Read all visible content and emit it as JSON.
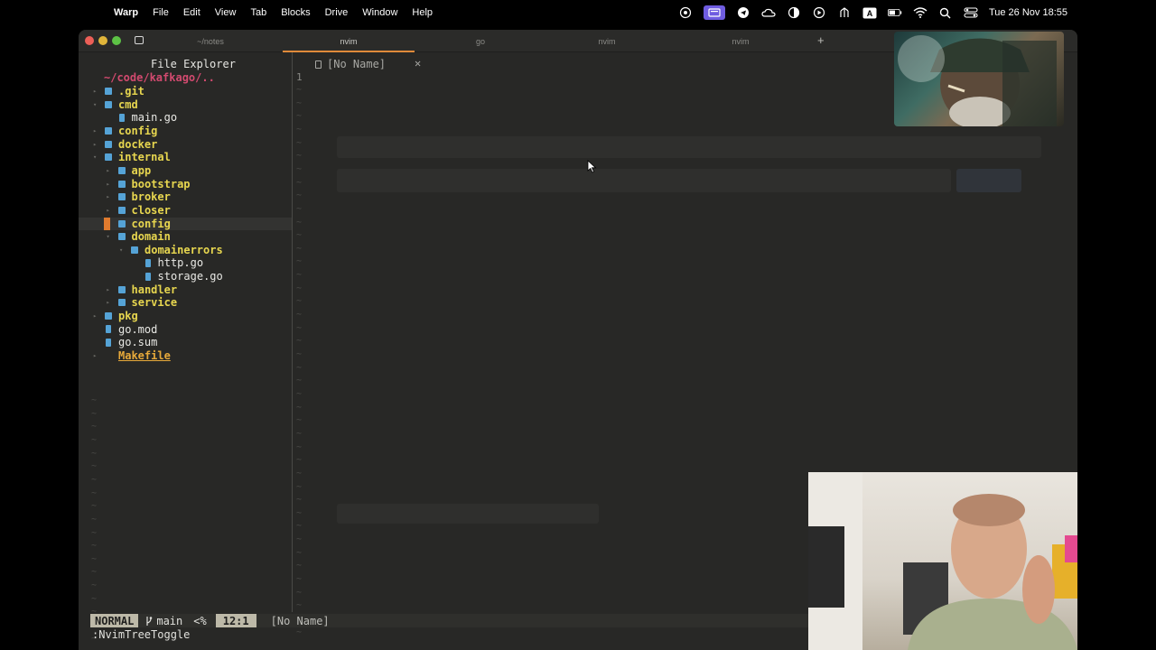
{
  "menubar": {
    "app": "Warp",
    "items": [
      "File",
      "Edit",
      "View",
      "Tab",
      "Blocks",
      "Drive",
      "Window",
      "Help"
    ],
    "clock": "Tue 26 Nov  18:55"
  },
  "window": {
    "tabs": [
      {
        "label": "~/notes",
        "active": false
      },
      {
        "label": "nvim",
        "active": true
      },
      {
        "label": "go",
        "active": false
      },
      {
        "label": "nvim",
        "active": false
      },
      {
        "label": "nvim",
        "active": false
      }
    ],
    "add_tab": "+"
  },
  "tree": {
    "header": "File Explorer",
    "root": "~/code/kafkago/..",
    "items": [
      {
        "name": ".git",
        "type": "dir",
        "depth": 1,
        "open": false
      },
      {
        "name": "cmd",
        "type": "dir",
        "depth": 1,
        "open": true
      },
      {
        "name": "main.go",
        "type": "file",
        "depth": 2
      },
      {
        "name": "config",
        "type": "dir",
        "depth": 1,
        "open": false
      },
      {
        "name": "docker",
        "type": "dir",
        "depth": 1,
        "open": false
      },
      {
        "name": "internal",
        "type": "dir",
        "depth": 1,
        "open": true
      },
      {
        "name": "app",
        "type": "dir",
        "depth": 2,
        "open": false
      },
      {
        "name": "bootstrap",
        "type": "dir",
        "depth": 2,
        "open": false
      },
      {
        "name": "broker",
        "type": "dir",
        "depth": 2,
        "open": false
      },
      {
        "name": "closer",
        "type": "dir",
        "depth": 2,
        "open": false
      },
      {
        "name": "config",
        "type": "dir",
        "depth": 2,
        "open": false,
        "selected": true
      },
      {
        "name": "domain",
        "type": "dir",
        "depth": 2,
        "open": true
      },
      {
        "name": "domainerrors",
        "type": "dir",
        "depth": 3,
        "open": true
      },
      {
        "name": "http.go",
        "type": "file",
        "depth": 4
      },
      {
        "name": "storage.go",
        "type": "file",
        "depth": 4
      },
      {
        "name": "handler",
        "type": "dir",
        "depth": 2,
        "open": false
      },
      {
        "name": "service",
        "type": "dir",
        "depth": 2,
        "open": false
      },
      {
        "name": "pkg",
        "type": "dir",
        "depth": 1,
        "open": false
      },
      {
        "name": "go.mod",
        "type": "file",
        "depth": 1
      },
      {
        "name": "go.sum",
        "type": "file",
        "depth": 1
      },
      {
        "name": "Makefile",
        "type": "make",
        "depth": 1
      }
    ]
  },
  "editor": {
    "tab_label": "[No Name]",
    "close": "✕",
    "line_number": "1"
  },
  "statusline": {
    "mode": "NORMAL",
    "branch": "main",
    "percent": "<%",
    "position": "12:1",
    "buffer": "[No Name]"
  },
  "cmdline": ":NvimTreeToggle",
  "colors": {
    "accent": "#e08a3a",
    "dir": "#e7d64f",
    "root": "#d24a6f",
    "icon": "#55a3d6",
    "bg": "#282826"
  }
}
